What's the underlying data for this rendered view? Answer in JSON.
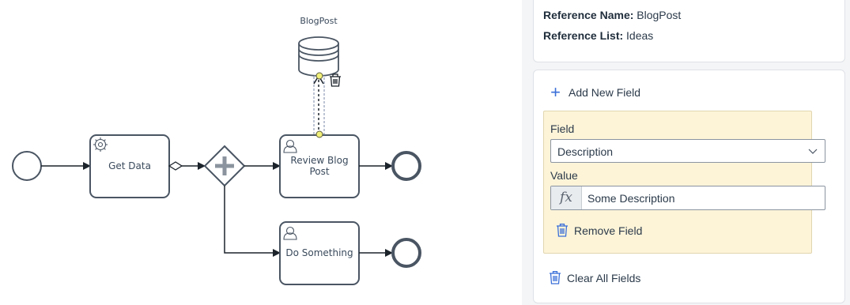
{
  "diagram": {
    "data_store_label": "BlogPost",
    "tasks": [
      {
        "id": "get-data",
        "label_lines": [
          "Get Data"
        ],
        "type": "service"
      },
      {
        "id": "review-blog-post",
        "label_lines": [
          "Review Blog",
          "Post"
        ],
        "type": "user"
      },
      {
        "id": "do-something",
        "label_lines": [
          "Do Something"
        ],
        "type": "user"
      }
    ],
    "gateway_type": "parallel",
    "colors": {
      "stroke": "#4a5563",
      "highlight": "#f1f07a"
    }
  },
  "panel": {
    "reference_name_label": "Reference Name:",
    "reference_name_value": "BlogPost",
    "reference_list_label": "Reference List:",
    "reference_list_value": "Ideas",
    "add_field_label": "Add New Field",
    "field_label": "Field",
    "field_value": "Description",
    "value_label": "Value",
    "value_prefix": "fx",
    "value_text": "Some Description",
    "remove_field_label": "Remove Field",
    "clear_all_label": "Clear All Fields",
    "colors": {
      "accent": "#3a6fd8",
      "field_bg": "#fdf4d8"
    }
  }
}
